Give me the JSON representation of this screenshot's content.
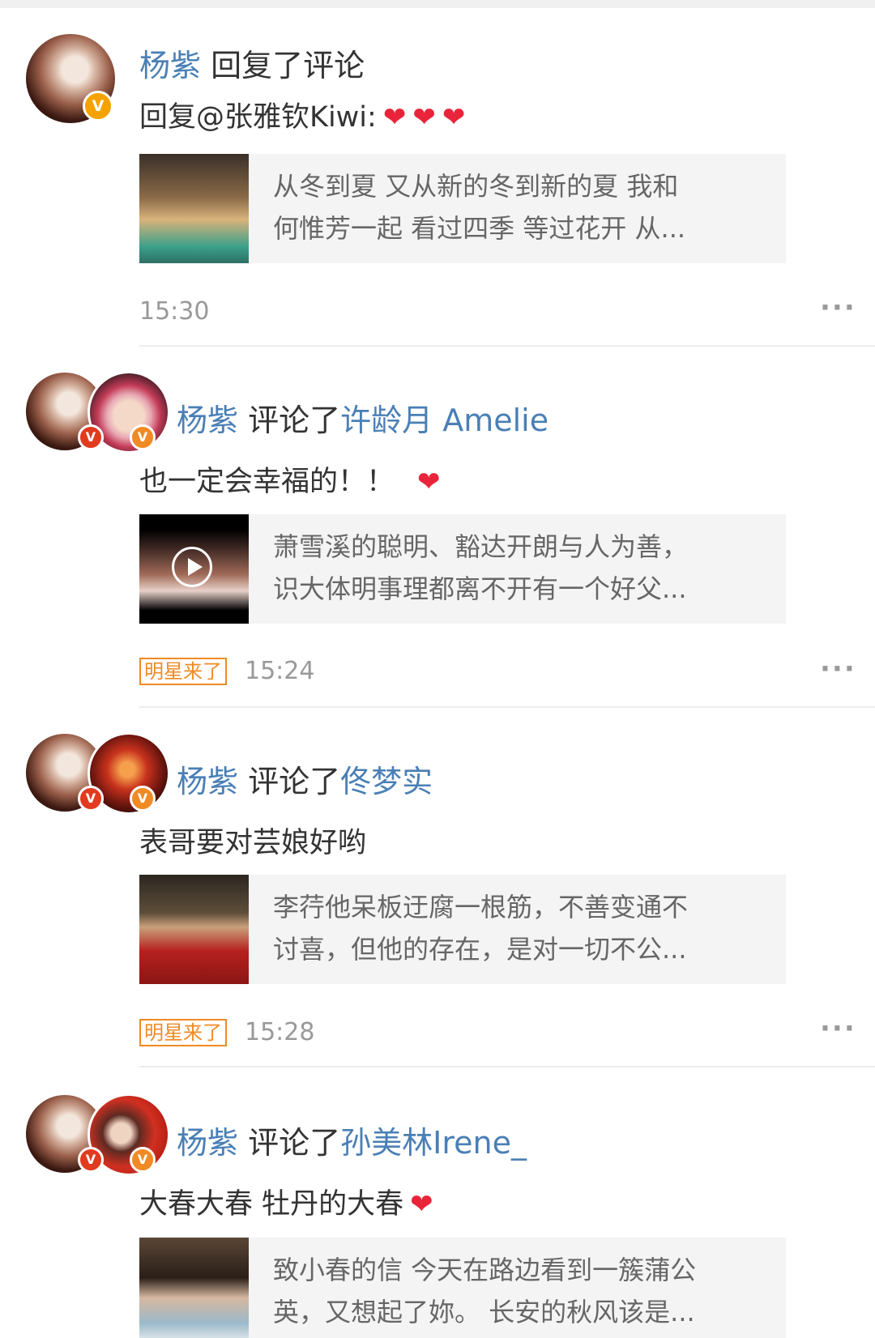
{
  "items": [
    {
      "user": "杨紫",
      "action": "回复了评论",
      "target": "",
      "text": "回复@张雅钦Kiwi:",
      "hearts": 3,
      "card": {
        "line1": "从冬到夏 又从新的冬到新的夏  我和",
        "line2": "何惟芳一起 看过四季 等过花开 从..."
      },
      "tag": "",
      "time": "15:30",
      "more": "···"
    },
    {
      "user": "杨紫",
      "action": "评论了",
      "target": "许龄月 Amelie",
      "text": "也一定会幸福的！！",
      "hearts": 1,
      "card": {
        "line1": "萧雪溪的聪明、豁达开朗与人为善，",
        "line2": "识大体明事理都离不开有一个好父..."
      },
      "tag": "明星来了",
      "time": "15:24",
      "more": "···"
    },
    {
      "user": "杨紫",
      "action": "评论了",
      "target": "佟梦实",
      "text": "表哥要对芸娘好哟",
      "hearts": 0,
      "card": {
        "line1": "李荇他呆板迂腐一根筋，不善变通不",
        "line2": "讨喜，但他的存在，是对一切不公..."
      },
      "tag": "明星来了",
      "time": "15:28",
      "more": "···"
    },
    {
      "user": "杨紫",
      "action": "评论了",
      "target": "孙美林Irene_",
      "text": "大春大春 牡丹的大春",
      "hearts": 1,
      "card": {
        "line1": "致小春的信  今天在路边看到一簇蒲公",
        "line2": "英，又想起了妳。  长安的秋风该是..."
      },
      "tag": "",
      "time": "",
      "more": ""
    }
  ],
  "icons": {
    "verified": "verified-v-badge",
    "heart": "red-heart",
    "play": "play-circle-icon",
    "more": "more-dots-icon"
  },
  "colors": {
    "link": "#4a7fb5",
    "heart": "#e9243a",
    "tag": "#f08a24",
    "verified": "#f5a200"
  }
}
